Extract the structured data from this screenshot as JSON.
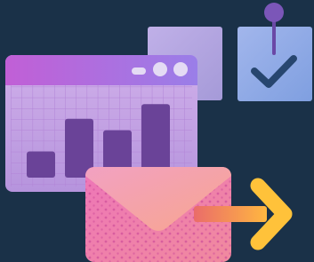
{
  "illustration": {
    "colors": {
      "background": "#1a3148",
      "window_title_bar": "#c15fd6",
      "window_body": "#c9a6e6",
      "window_grid": "#b889d9",
      "chart_bars": "#6a4398",
      "back_card": "#b6a6e2",
      "task_card": "#93aee6",
      "pin": "#7b56b8",
      "checkmark": "#27466f",
      "envelope": "#e76fb5",
      "envelope_flap": "#f6a19a",
      "arrow": "#ffc23a",
      "arrow_tail": "#ef7a52"
    },
    "chart_data": {
      "type": "bar",
      "categories": [
        "",
        "",
        "",
        ""
      ],
      "values": [
        32,
        72,
        58,
        90
      ],
      "ylim": [
        0,
        100
      ]
    },
    "icons": {
      "window": "browser-window-icon",
      "checklist_card": "task-check-icon",
      "pin": "push-pin-icon",
      "envelope": "envelope-icon",
      "arrow": "arrow-right-icon"
    }
  }
}
